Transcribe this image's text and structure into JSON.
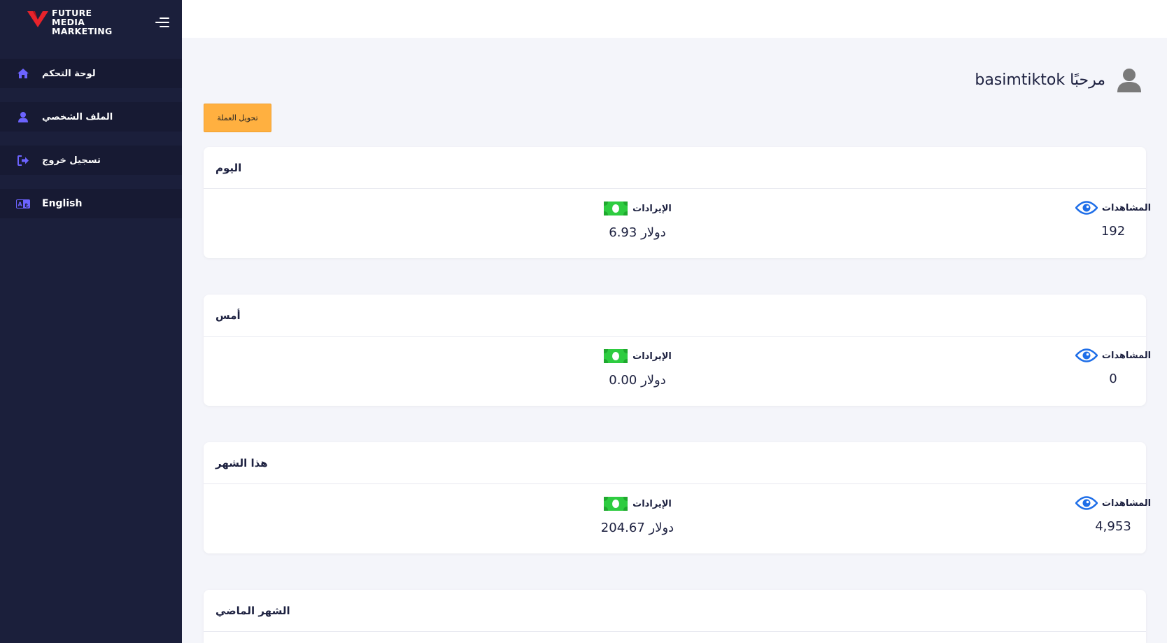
{
  "brand": {
    "line1": "FUTURE",
    "line2": "MEDIA",
    "line3": "MARKETING",
    "color": "#e8232b"
  },
  "sidebar": {
    "items": [
      {
        "label": "لوحة التحكم",
        "icon": "home-icon"
      },
      {
        "label": "الملف الشخصي",
        "icon": "user-icon"
      },
      {
        "label": "تسجيل خروج",
        "icon": "logout-icon"
      },
      {
        "label": "English",
        "icon": "language-icon"
      }
    ],
    "accent": "#6c63ff"
  },
  "header": {
    "greeting_prefix": "مرحبًا",
    "username": "basimtiktok"
  },
  "actions": {
    "convert_currency": "تحويل العملة"
  },
  "stats_labels": {
    "views": "المشاهدات",
    "revenue": "الإيرادات",
    "currency": "دولار"
  },
  "cards": [
    {
      "title": "اليوم",
      "views": "192",
      "revenue": "6.93 دولار"
    },
    {
      "title": "أمس",
      "views": "0",
      "revenue": "0.00 دولار"
    },
    {
      "title": "هذا الشهر",
      "views": "4,953",
      "revenue": "204.67 دولار"
    },
    {
      "title": "الشهر الماضي"
    }
  ],
  "colors": {
    "sidebar_bg": "#1b1f3b",
    "button_bg": "#ffb040",
    "eye_icon": "#1e6ee8",
    "money_icon": "#2ecc40"
  }
}
